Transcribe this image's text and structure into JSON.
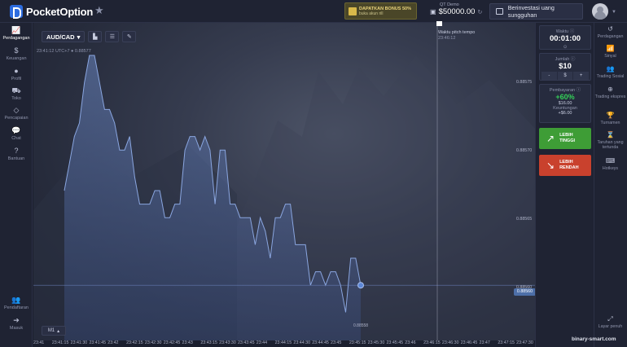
{
  "app": {
    "name": "PocketOption"
  },
  "header": {
    "bonus_line1": "DAPATKAN BONUS 50%",
    "bonus_line2": "buka akun rill",
    "account_label": "QT Demo",
    "balance": "$50000.00",
    "real_button": "Berinvestasi uang sungguhan"
  },
  "left_sidebar": [
    {
      "label": "Perdagangan",
      "icon": "chart-line-icon"
    },
    {
      "label": "Keuangan",
      "icon": "dollar-icon"
    },
    {
      "label": "Profil",
      "icon": "user-icon"
    },
    {
      "label": "Toko",
      "icon": "cart-icon"
    },
    {
      "label": "Pencapaian",
      "icon": "diamond-icon"
    },
    {
      "label": "Chat",
      "icon": "chat-icon"
    },
    {
      "label": "Bantuan",
      "icon": "help-icon"
    },
    {
      "label": "Pendaftaran",
      "icon": "add-user-icon"
    },
    {
      "label": "Masuk",
      "icon": "login-icon"
    }
  ],
  "chart_toolbar": {
    "pair": "AUD/CAD"
  },
  "chart_info": {
    "time": "23:41:12",
    "utc": "UTC+7",
    "price": "0.88577"
  },
  "expiry": {
    "label": "Waktu pitch tempo",
    "time": "23:46:12"
  },
  "timeframe": "M1",
  "chart_data": {
    "type": "line",
    "ylim": [
      0.88557,
      0.88577
    ],
    "y_ticks": [
      "0.88575",
      "0.88570",
      "0.88565",
      "0.88560"
    ],
    "current_price": "0.88560",
    "low_price_label": "0.88558",
    "x_ticks": [
      "23:41",
      "23:41:15",
      "23:41:30",
      "23:41:45",
      "23:42",
      "23:42:15",
      "23:42:30",
      "23:42:45",
      "23:43",
      "23:43:15",
      "23:43:30",
      "23:43:45",
      "23:44",
      "23:44:15",
      "23:44:30",
      "23:44:45",
      "23:45",
      "23:45:15",
      "23:45:30",
      "23:45:45",
      "23:46",
      "23:46:15",
      "23:46:30",
      "23:46:45",
      "23:47",
      "23:47:15",
      "23:47:30"
    ],
    "values": [
      0.88567,
      0.88569,
      0.88571,
      0.88572,
      0.88575,
      0.88577,
      0.88577,
      0.88575,
      0.88573,
      0.88573,
      0.88572,
      0.8857,
      0.8857,
      0.88571,
      0.88568,
      0.88566,
      0.88566,
      0.88566,
      0.88567,
      0.88567,
      0.88565,
      0.88565,
      0.88566,
      0.88566,
      0.8857,
      0.88571,
      0.88571,
      0.8857,
      0.88571,
      0.8857,
      0.88566,
      0.8857,
      0.8857,
      0.88566,
      0.88566,
      0.88565,
      0.88565,
      0.88565,
      0.88563,
      0.88565,
      0.88564,
      0.88562,
      0.88565,
      0.88565,
      0.88566,
      0.88566,
      0.88563,
      0.88563,
      0.88563,
      0.8856,
      0.88561,
      0.88561,
      0.8856,
      0.88561,
      0.88561,
      0.8856,
      0.88558,
      0.88562,
      0.88562,
      0.8856
    ]
  },
  "right_panel": {
    "time_label": "Waktu",
    "time_value": "00:01:00",
    "amount_label": "Jumlah",
    "amount_value": "$10",
    "minus": "-",
    "currency": "$",
    "plus": "+",
    "payout_label": "Pembayaran",
    "payout_pct": "+60%",
    "payout_amount": "$16.00",
    "profit_label": "Keuntungan",
    "profit_value": "+$6.00",
    "up_label_1": "LEBIH",
    "up_label_2": "TINGGI",
    "down_label_1": "LEBIH",
    "down_label_2": "RENDAH"
  },
  "right_sidebar": [
    {
      "label": "Perdagangan",
      "icon": "history-icon"
    },
    {
      "label": "Sinyal",
      "icon": "signal-icon"
    },
    {
      "label": "Trading Sosial",
      "icon": "social-icon"
    },
    {
      "label": "Trading ekspres",
      "icon": "express-icon"
    },
    {
      "label": "Turnamen",
      "icon": "trophy-icon"
    },
    {
      "label": "Taruhan yang tertunda",
      "icon": "hourglass-icon"
    },
    {
      "label": "Hotkeys",
      "icon": "keyboard-icon"
    },
    {
      "label": "Layar penuh",
      "icon": "fullscreen-icon"
    }
  ],
  "watermark": "binary-smart.com"
}
